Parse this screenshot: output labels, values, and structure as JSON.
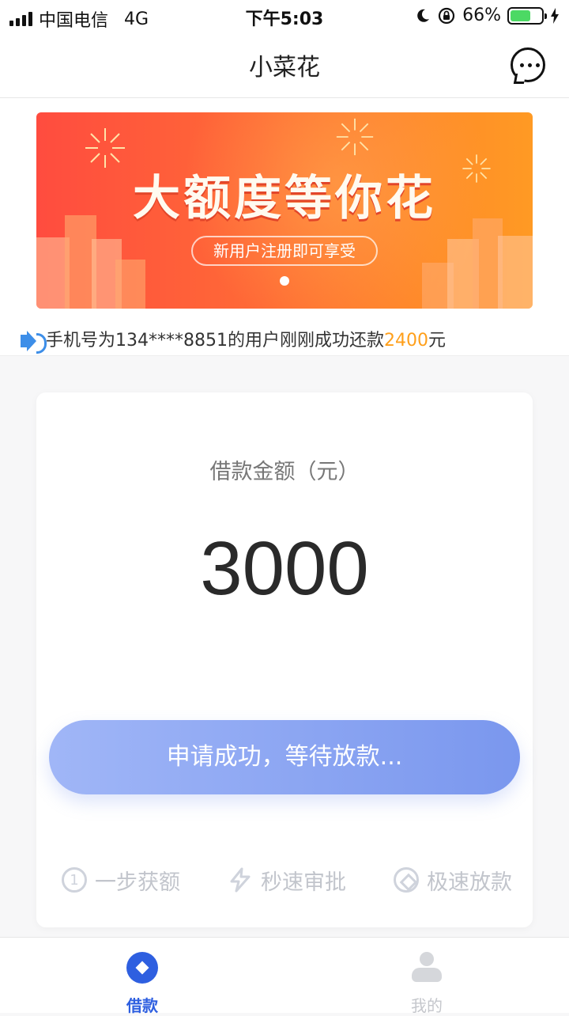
{
  "status_bar": {
    "carrier": "中国电信",
    "network": "4G",
    "time": "下午5:03",
    "battery_percent": "66%",
    "battery_level": 0.66,
    "battery_color": "#4cd964"
  },
  "nav": {
    "title": "小菜花",
    "right_icon": "chat-bubble-icon"
  },
  "banner": {
    "headline": "大额度等你花",
    "subline": "新用户注册即可享受",
    "page_indicator": {
      "count": 1,
      "active": 0
    },
    "background_colors": [
      "#ff4c3f",
      "#ff9a24"
    ]
  },
  "notice": {
    "icon": "speaker-icon",
    "text_prefix": "手机号为134****8851的用户刚刚成功还款",
    "amount": "2400",
    "unit": "元",
    "amount_color": "#ff9f1a"
  },
  "loan_card": {
    "label": "借款金额（元）",
    "amount": "3000",
    "button_label": "申请成功，等待放款...",
    "button_colors": [
      "#a0b6f7",
      "#7a97ee"
    ],
    "features": [
      {
        "icon": "step-one-icon",
        "icon_text": "1",
        "label": "一步获额"
      },
      {
        "icon": "lightning-icon",
        "label": "秒速审批"
      },
      {
        "icon": "diamond-icon",
        "label": "极速放款"
      }
    ]
  },
  "tab_bar": {
    "tabs": [
      {
        "icon": "loan-icon",
        "label": "借款",
        "active": true
      },
      {
        "icon": "user-icon",
        "label": "我的",
        "active": false
      }
    ],
    "active_color": "#2e5fe0"
  }
}
